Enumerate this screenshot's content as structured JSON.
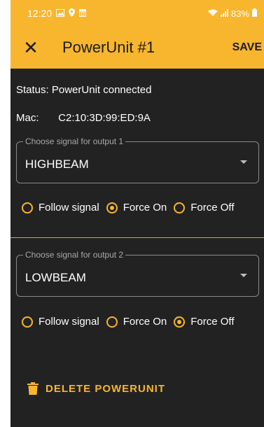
{
  "statusbar": {
    "time": "12:20",
    "battery": "83%",
    "icons": [
      "gallery-icon",
      "location-pin-icon",
      "calendar-icon",
      "wifi-icon",
      "signal-icon",
      "battery-icon"
    ]
  },
  "appbar": {
    "title": "PowerUnit #1",
    "save_label": "SAVE"
  },
  "device": {
    "status_label": "Status:",
    "status_value": "PowerUnit connected",
    "mac_label": "Mac:",
    "mac_value": "C2:10:3D:99:ED:9A"
  },
  "output1": {
    "legend": "Choose signal for output 1",
    "value": "HIGHBEAM",
    "options": [
      {
        "label": "Follow signal",
        "selected": false
      },
      {
        "label": "Force On",
        "selected": true
      },
      {
        "label": "Force Off",
        "selected": false
      }
    ]
  },
  "output2": {
    "legend": "Choose signal for output 2",
    "value": "LOWBEAM",
    "options": [
      {
        "label": "Follow signal",
        "selected": false
      },
      {
        "label": "Force On",
        "selected": false
      },
      {
        "label": "Force Off",
        "selected": true
      }
    ]
  },
  "actions": {
    "delete_label": "DELETE POWERUNIT"
  },
  "colors": {
    "accent": "#f8b62e",
    "background": "#222222",
    "text": "#ffffff"
  }
}
